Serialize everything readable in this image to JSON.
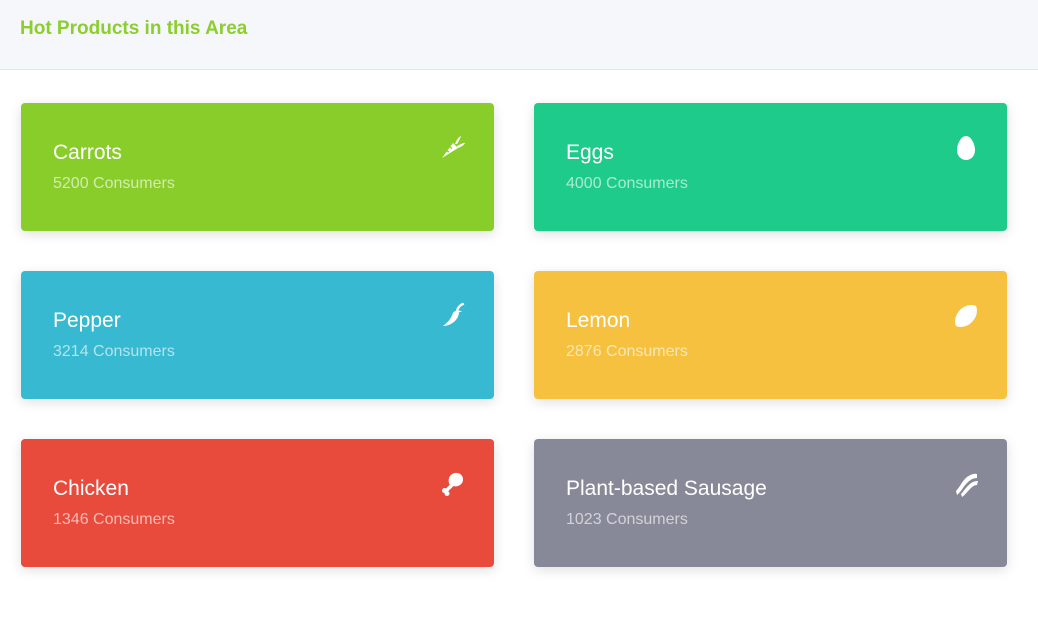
{
  "header": {
    "title": "Hot Products in this Area"
  },
  "products": [
    {
      "name": "Carrots",
      "consumers": "5200 Consumers",
      "color": "#89cd2b",
      "icon": "carrot-icon"
    },
    {
      "name": "Eggs",
      "consumers": "4000 Consumers",
      "color": "#1ecb8a",
      "icon": "egg-icon"
    },
    {
      "name": "Pepper",
      "consumers": "3214 Consumers",
      "color": "#36b9d1",
      "icon": "pepper-icon"
    },
    {
      "name": "Lemon",
      "consumers": "2876 Consumers",
      "color": "#f5c13e",
      "icon": "lemon-icon"
    },
    {
      "name": "Chicken",
      "consumers": "1346 Consumers",
      "color": "#e84a3b",
      "icon": "drumstick-icon"
    },
    {
      "name": "Plant-based Sausage",
      "consumers": "1023 Consumers",
      "color": "#878999",
      "icon": "bacon-icon"
    }
  ],
  "colors": {
    "title_accent": "#8bce2d",
    "header_background": "#f6f7fb"
  }
}
